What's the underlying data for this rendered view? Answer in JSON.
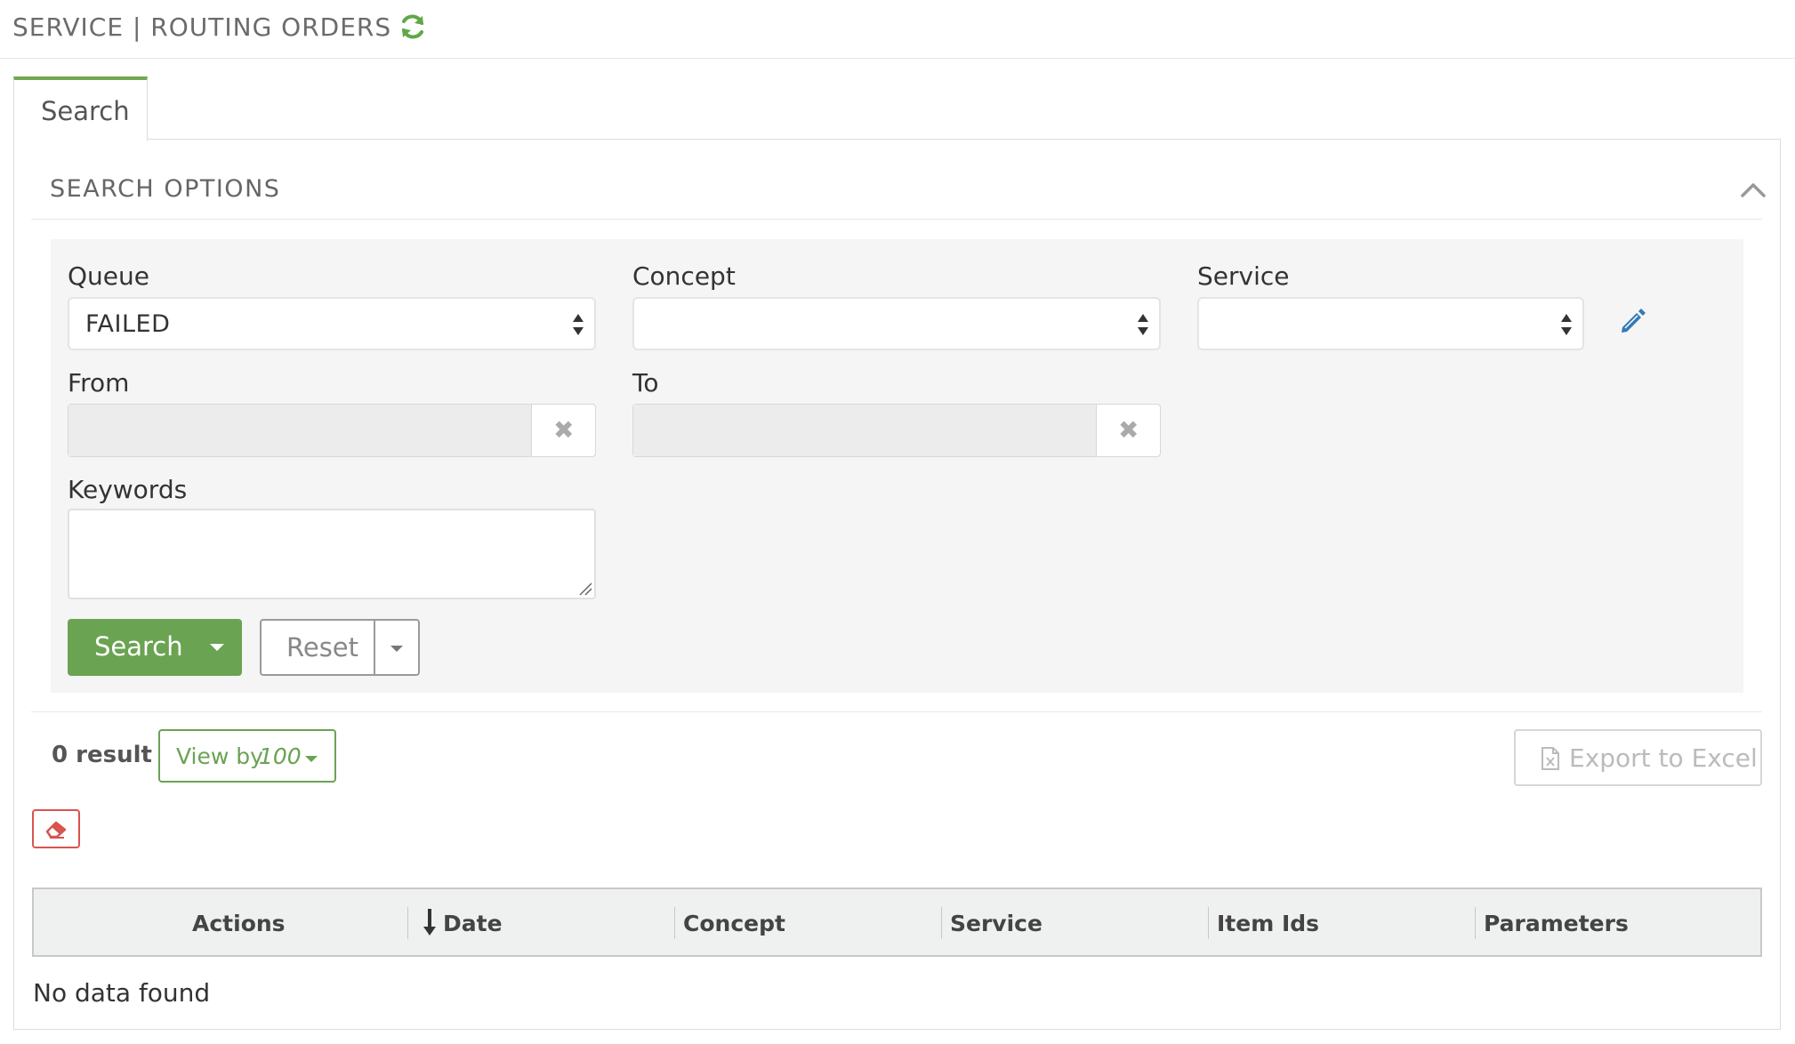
{
  "header": {
    "title": "SERVICE | ROUTING ORDERS",
    "refresh_icon": "refresh-icon"
  },
  "tabs": [
    {
      "label": "Search",
      "active": true
    }
  ],
  "search_options": {
    "title": "SEARCH OPTIONS",
    "collapse_icon": "chevron-up-icon",
    "fields": {
      "queue": {
        "label": "Queue",
        "value": "FAILED"
      },
      "concept": {
        "label": "Concept",
        "value": ""
      },
      "service": {
        "label": "Service",
        "value": ""
      },
      "from": {
        "label": "From",
        "value": "",
        "clear": "✖"
      },
      "to": {
        "label": "To",
        "value": "",
        "clear": "✖"
      },
      "keywords": {
        "label": "Keywords",
        "value": ""
      }
    },
    "buttons": {
      "search": "Search",
      "reset": "Reset"
    }
  },
  "results": {
    "count_text": "0 result",
    "view_by_label": "View by",
    "view_by_value": "100",
    "export_label": "Export to Excel"
  },
  "table": {
    "columns": [
      "Actions",
      "Date",
      "Concept",
      "Service",
      "Item Ids",
      "Parameters"
    ],
    "sorted_column": "Date",
    "sort_direction": "desc",
    "empty_text": "No data found"
  },
  "colors": {
    "accent_green": "#6aa352",
    "danger_red": "#d9534f",
    "link_blue": "#337ab7"
  }
}
